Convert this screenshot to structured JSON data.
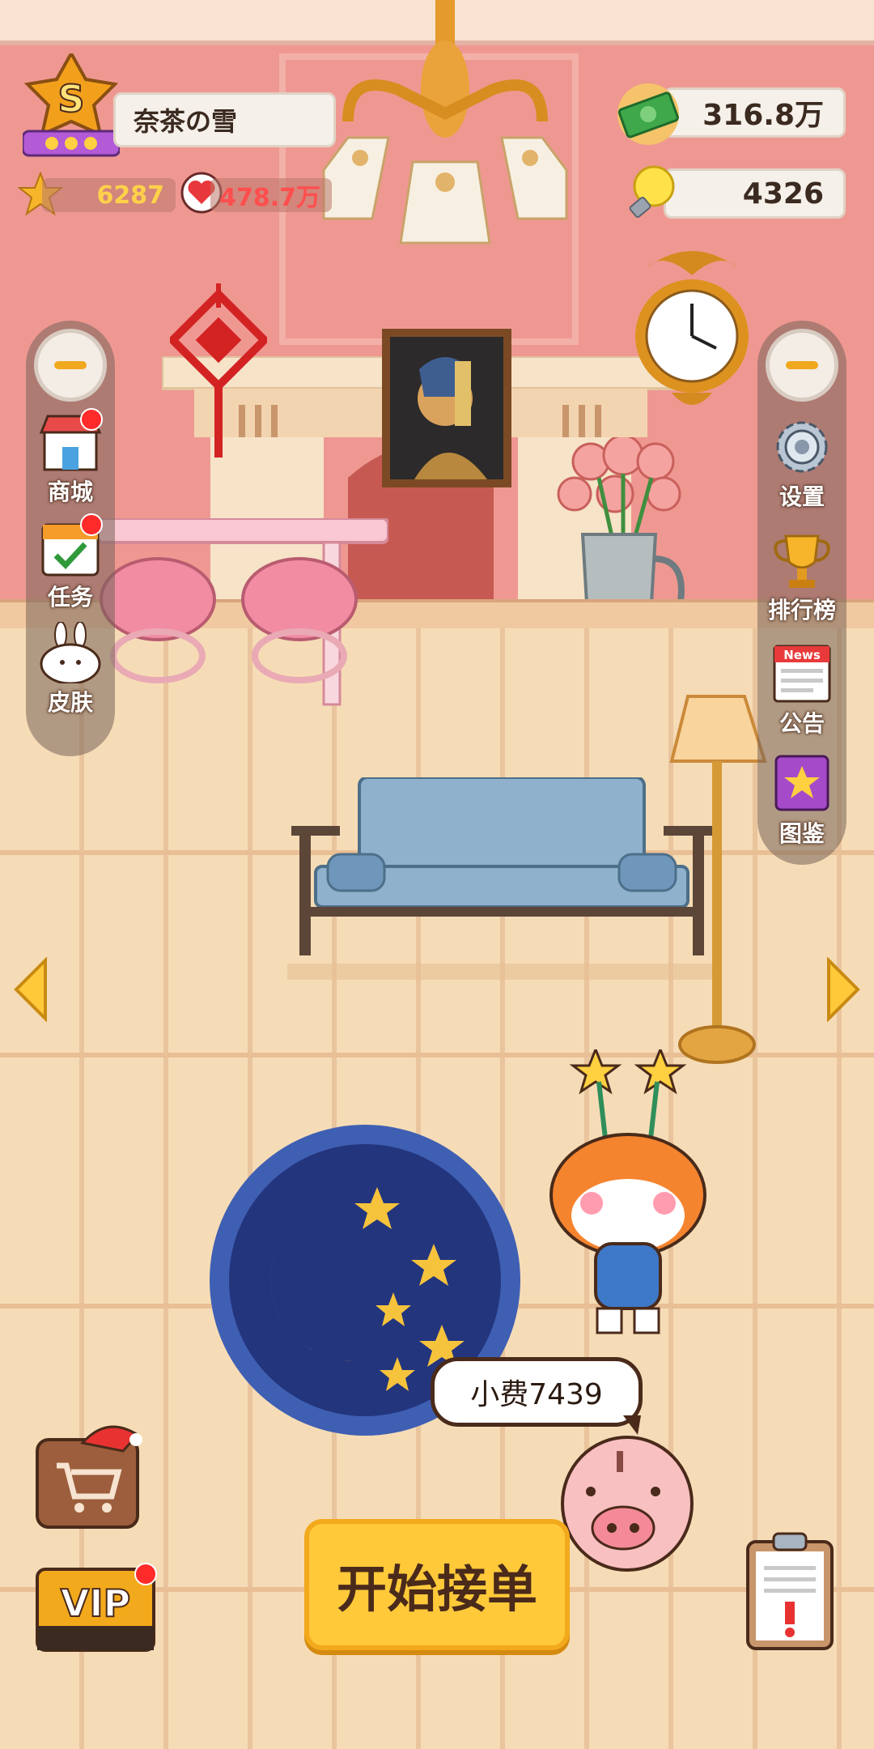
{
  "player": {
    "name": "奈茶の雪",
    "rank_letter": "S",
    "stars": "6287",
    "likes": "478.7万"
  },
  "currency": {
    "money": "316.8万",
    "bulbs": "4326"
  },
  "left_menu": [
    {
      "label": "商城",
      "icon": "shop-icon",
      "has_dot": true
    },
    {
      "label": "任务",
      "icon": "task-calendar-icon",
      "has_dot": true
    },
    {
      "label": "皮肤",
      "icon": "skin-bunny-icon",
      "has_dot": false
    }
  ],
  "right_menu": [
    {
      "label": "设置",
      "icon": "gear-icon"
    },
    {
      "label": "排行榜",
      "icon": "trophy-icon"
    },
    {
      "label": "公告",
      "icon": "news-icon",
      "icon_text": "News"
    },
    {
      "label": "图鉴",
      "icon": "star-book-icon"
    }
  ],
  "tip": {
    "text": "小费7439"
  },
  "start_button": {
    "label": "开始接单"
  },
  "vip": {
    "label": "VIP"
  },
  "colors": {
    "wall": "#ef9892",
    "floor": "#f6dcb6",
    "accent": "#ffc93a",
    "notification": "#ff2a2a"
  }
}
